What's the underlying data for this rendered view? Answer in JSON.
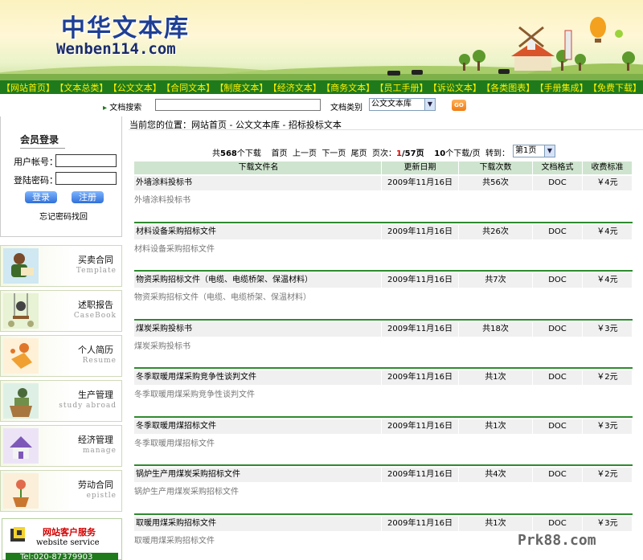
{
  "header": {
    "logo_cn": "中华文本库",
    "logo_en": "Wenben114.com"
  },
  "nav": [
    "【网站首页】",
    "【文本总类】",
    "【公文文本】",
    "【合同文本】",
    "【制度文本】",
    "【经济文本】",
    "【商务文本】",
    "【员工手册】",
    "【诉讼文本】",
    "【各类图表】",
    "【手册集成】",
    "【免费下载】"
  ],
  "search": {
    "label": "文档搜索",
    "type_label": "文档类别",
    "type_value": "公文文本库",
    "go_label": "GO"
  },
  "login": {
    "title": "会员登录",
    "username_label": "用户帐号：",
    "password_label": "登陆密码：",
    "login_button": "登录",
    "register_button": "注册",
    "forgot": "忘记密码找回"
  },
  "categories": [
    {
      "cn": "买卖合同",
      "en": "Template"
    },
    {
      "cn": "述职报告",
      "en": "CaseBook"
    },
    {
      "cn": "个人简历",
      "en": "Resume"
    },
    {
      "cn": "生产管理",
      "en": "study abroad"
    },
    {
      "cn": "经济管理",
      "en": "manage"
    },
    {
      "cn": "劳动合同",
      "en": "epistle"
    }
  ],
  "service": {
    "title": "网站客户服务",
    "subtitle": "website service",
    "tel": "Tel:020-87379903"
  },
  "breadcrumb": "当前您的位置：网站首页 - 公文文本库 - 招标投标文本",
  "pager": {
    "total_prefix": "共",
    "total": "568",
    "total_suffix": "个下载",
    "first": "首页",
    "prev": "上一页",
    "next": "下一页",
    "last": "尾页",
    "page_label": "页次：",
    "current": "1",
    "pages": "/57页",
    "per_page_num": "10",
    "per_page": "个下载/页",
    "goto": "转到：",
    "goto_value": "第1页"
  },
  "table": {
    "headers": [
      "下载文件名",
      "更新日期",
      "下载次数",
      "文档格式",
      "收费标准"
    ],
    "rows": [
      {
        "name": "外墙涂料投标书",
        "date": "2009年11月16日",
        "count": "共56次",
        "format": "DOC",
        "fee": "￥4元",
        "desc": "外墙涂料投标书"
      },
      {
        "name": "材料设备采购招标文件",
        "date": "2009年11月16日",
        "count": "共26次",
        "format": "DOC",
        "fee": "￥4元",
        "desc": "材料设备采购招标文件"
      },
      {
        "name": "物资采购招标文件（电缆、电缆桥架、保温材料）",
        "date": "2009年11月16日",
        "count": "共7次",
        "format": "DOC",
        "fee": "￥4元",
        "desc": "物资采购招标文件（电缆、电缆桥架、保温材料）"
      },
      {
        "name": "煤炭采购投标书",
        "date": "2009年11月16日",
        "count": "共18次",
        "format": "DOC",
        "fee": "￥3元",
        "desc": "煤炭采购投标书"
      },
      {
        "name": "冬季取暖用煤采购竞争性谈判文件",
        "date": "2009年11月16日",
        "count": "共1次",
        "format": "DOC",
        "fee": "￥2元",
        "desc": "冬季取暖用煤采购竞争性谈判文件"
      },
      {
        "name": "冬季取暖用煤招标文件",
        "date": "2009年11月16日",
        "count": "共1次",
        "format": "DOC",
        "fee": "￥3元",
        "desc": "冬季取暖用煤招标文件"
      },
      {
        "name": "锅炉生产用煤炭采购招标文件",
        "date": "2009年11月16日",
        "count": "共4次",
        "format": "DOC",
        "fee": "￥2元",
        "desc": "锅炉生产用煤炭采购招标文件"
      },
      {
        "name": "取暖用煤采购招标文件",
        "date": "2009年11月16日",
        "count": "共1次",
        "format": "DOC",
        "fee": "￥3元",
        "desc": "取暖用煤采购招标文件"
      }
    ]
  },
  "watermark": "Prk88.com"
}
